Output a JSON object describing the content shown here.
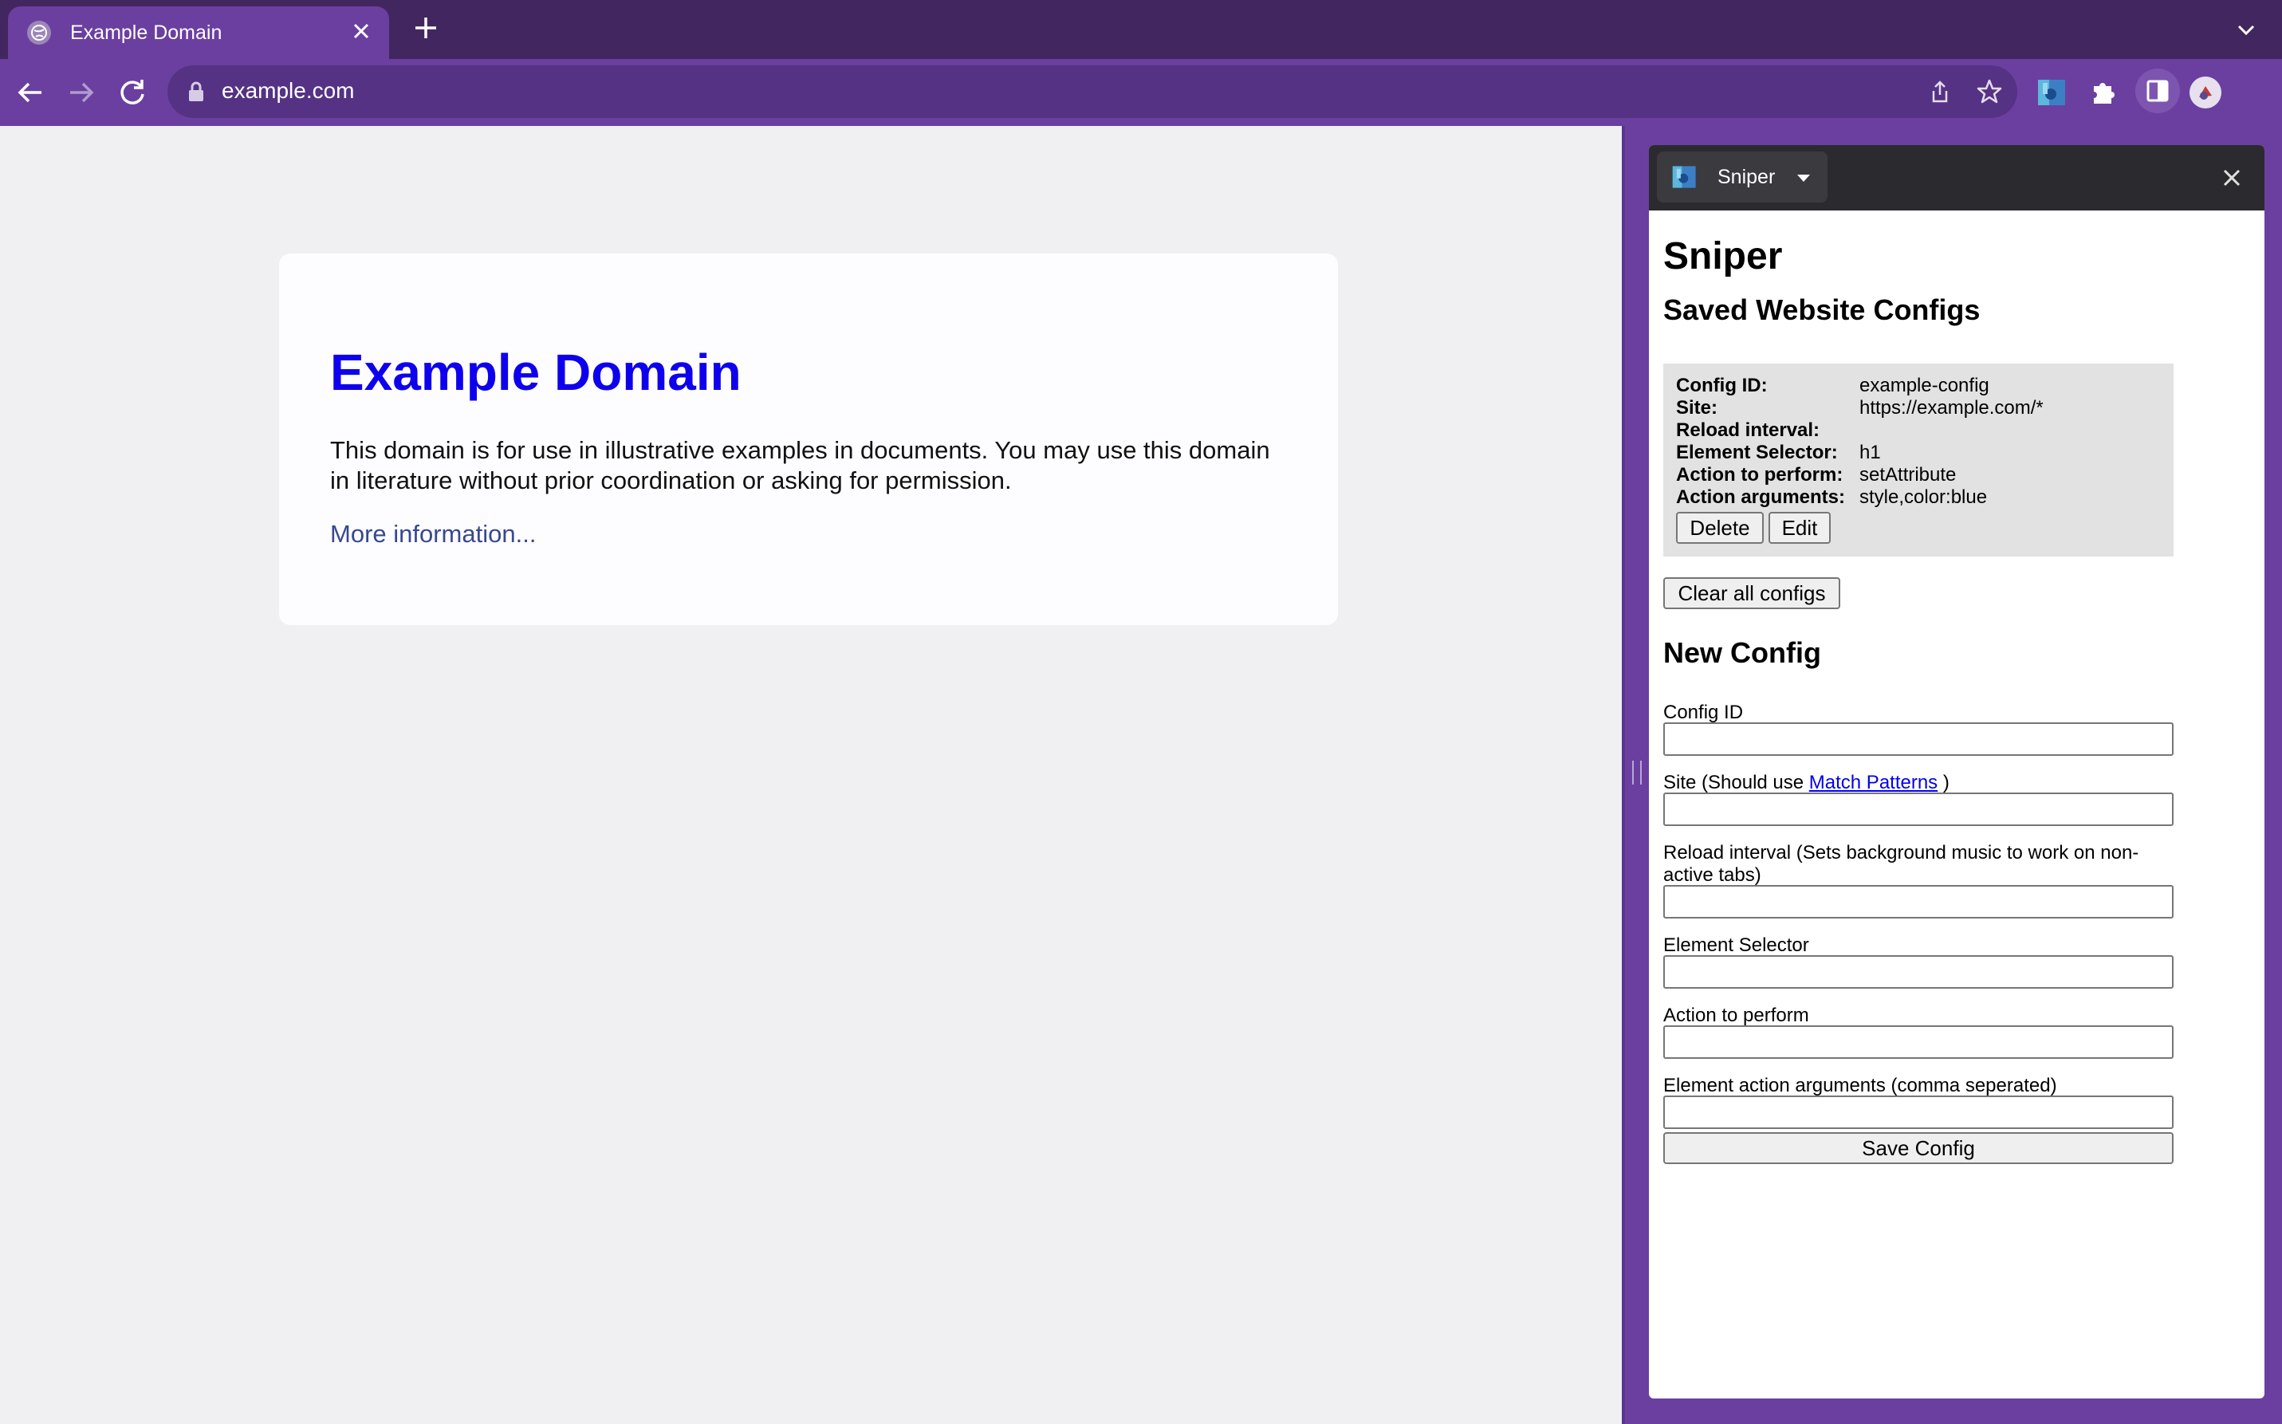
{
  "browser": {
    "tab": {
      "title": "Example Domain"
    },
    "address": {
      "url": "example.com"
    }
  },
  "page": {
    "heading": "Example Domain",
    "body_text": "This domain is for use in illustrative examples in documents. You may use this domain in literature without prior coordination or asking for permission.",
    "link_text": "More information..."
  },
  "sidepanel": {
    "selector_name": "Sniper",
    "title": "Sniper",
    "saved_heading": "Saved Website Configs",
    "saved_config": {
      "rows": [
        {
          "key": "Config ID:",
          "value": "example-config"
        },
        {
          "key": "Site:",
          "value": "https://example.com/*"
        },
        {
          "key": "Reload interval:",
          "value": ""
        },
        {
          "key": "Element Selector:",
          "value": "h1"
        },
        {
          "key": "Action to perform:",
          "value": "setAttribute"
        },
        {
          "key": "Action arguments:",
          "value": "style,color:blue"
        }
      ],
      "delete_label": "Delete",
      "edit_label": "Edit"
    },
    "clear_label": "Clear all configs",
    "new_heading": "New Config",
    "form": {
      "config_id_label": "Config ID",
      "site_label_prefix": "Site (Should use ",
      "site_label_link": "Match Patterns",
      "site_label_suffix": " )",
      "reload_label": "Reload interval (Sets background music to work on non-active tabs)",
      "selector_label": "Element Selector",
      "action_label": "Action to perform",
      "args_label": "Element action arguments (comma seperated)",
      "config_id_value": "",
      "site_value": "",
      "reload_value": "",
      "selector_value": "",
      "action_value": "",
      "args_value": "",
      "save_label": "Save Config"
    }
  },
  "colors": {
    "browser_frame": "#6b3fa0",
    "tabstrip": "#42265f",
    "heading_blue": "#0e00ec",
    "link": "#38488f"
  }
}
